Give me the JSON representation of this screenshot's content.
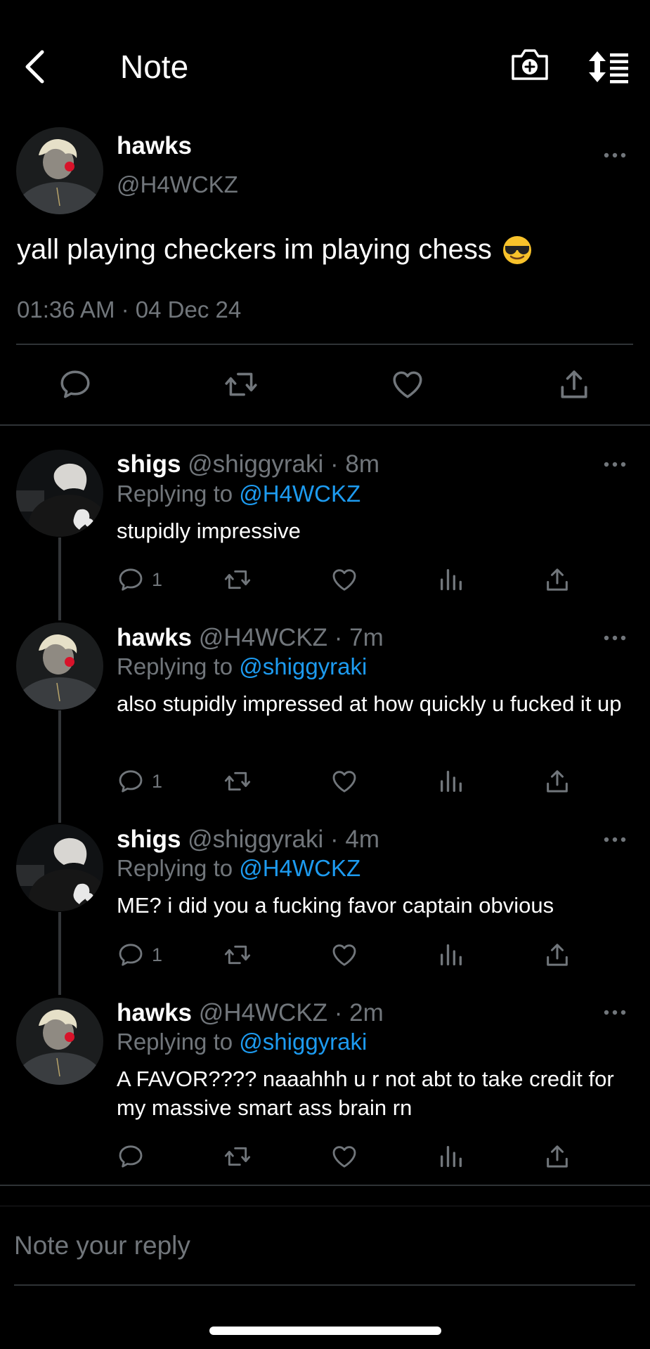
{
  "header": {
    "title": "Note",
    "back_icon": "chevron-left-icon",
    "camera_icon": "camera-plus-icon",
    "sort_icon": "sort-list-icon"
  },
  "main_post": {
    "name": "hawks",
    "handle": "@H4WCKZ",
    "text": "yall playing checkers im playing chess",
    "emoji": "😎",
    "timestamp": "01:36 AM · 04 Dec 24"
  },
  "replies": [
    {
      "name": "shigs",
      "meta": "@shiggyraki · 8m",
      "replying_label": "Replying to",
      "replying_to": "@H4WCKZ",
      "text": "stupidly impressive",
      "reply_count": "1"
    },
    {
      "name": "hawks",
      "meta": "@H4WCKZ · 7m",
      "replying_label": "Replying to",
      "replying_to": "@shiggyraki",
      "text": "also stupidly impressed at how quickly u fucked it up",
      "reply_count": "1"
    },
    {
      "name": "shigs",
      "meta": "@shiggyraki · 4m",
      "replying_label": "Replying to",
      "replying_to": "@H4WCKZ",
      "text": "ME? i did you a fucking favor captain obvious",
      "reply_count": "1"
    },
    {
      "name": "hawks",
      "meta": "@H4WCKZ · 2m",
      "replying_label": "Replying to",
      "replying_to": "@shiggyraki",
      "text": "A FAVOR???? naaahhh u r not abt to take credit for my massive smart ass brain rn",
      "reply_count": ""
    }
  ],
  "reply_input": {
    "placeholder": "Note your reply"
  },
  "colors": {
    "background": "#000000",
    "secondary_text": "#71767b",
    "link_blue": "#1d9bf0",
    "divider": "#2f3336"
  }
}
